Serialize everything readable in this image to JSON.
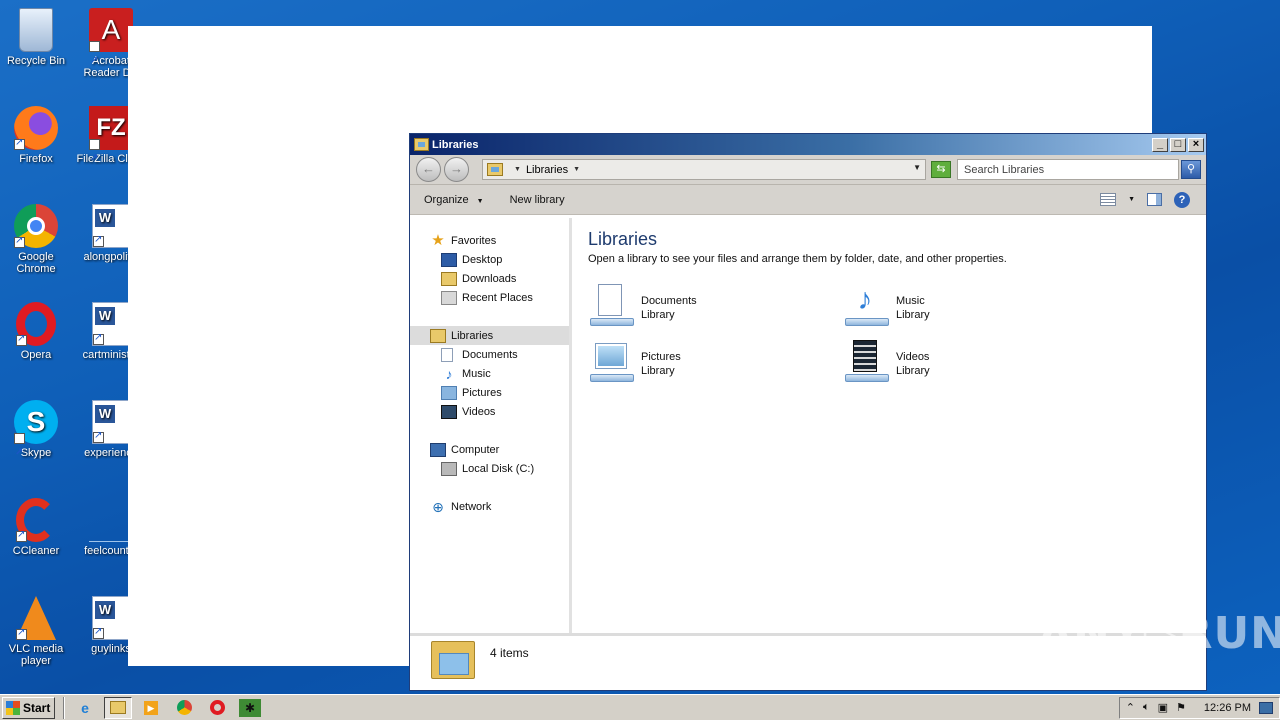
{
  "desktop": {
    "icons": [
      {
        "label": "Recycle Bin"
      },
      {
        "label": "Acrobat Reader DC"
      },
      {
        "label": "Firefox"
      },
      {
        "label": "FileZilla Client"
      },
      {
        "label": "Google Chrome"
      },
      {
        "label": "alongpolitic"
      },
      {
        "label": "Opera"
      },
      {
        "label": "cartminister"
      },
      {
        "label": "Skype"
      },
      {
        "label": "experience"
      },
      {
        "label": "CCleaner"
      },
      {
        "label": "feelcountry"
      },
      {
        "label": "VLC media player"
      },
      {
        "label": "guylinks"
      }
    ]
  },
  "explorer": {
    "title": "Libraries",
    "window_buttons": {
      "minimize": "_",
      "maximize": "□",
      "close": "×"
    },
    "address": {
      "crumb": "Libraries"
    },
    "search": {
      "placeholder": "Search Libraries"
    },
    "commands": {
      "organize": "Organize",
      "new_library": "New library"
    },
    "nav": {
      "favorites": "Favorites",
      "desktop": "Desktop",
      "downloads": "Downloads",
      "recent_places": "Recent Places",
      "libraries": "Libraries",
      "documents": "Documents",
      "music": "Music",
      "pictures": "Pictures",
      "videos": "Videos",
      "computer": "Computer",
      "local_disk": "Local Disk (C:)",
      "network": "Network"
    },
    "content": {
      "heading": "Libraries",
      "description": "Open a library to see your files and arrange them by folder, date, and other properties.",
      "libraries": [
        {
          "name": "Documents",
          "type": "Library",
          "icon": "documents-library-icon"
        },
        {
          "name": "Music",
          "type": "Library",
          "icon": "music-library-icon"
        },
        {
          "name": "Pictures",
          "type": "Library",
          "icon": "pictures-library-icon"
        },
        {
          "name": "Videos",
          "type": "Library",
          "icon": "videos-library-icon"
        }
      ]
    },
    "details": {
      "count": "4 items"
    }
  },
  "taskbar": {
    "start": "Start",
    "clock": "12:26 PM"
  },
  "watermark": "ANY▷RUN"
}
